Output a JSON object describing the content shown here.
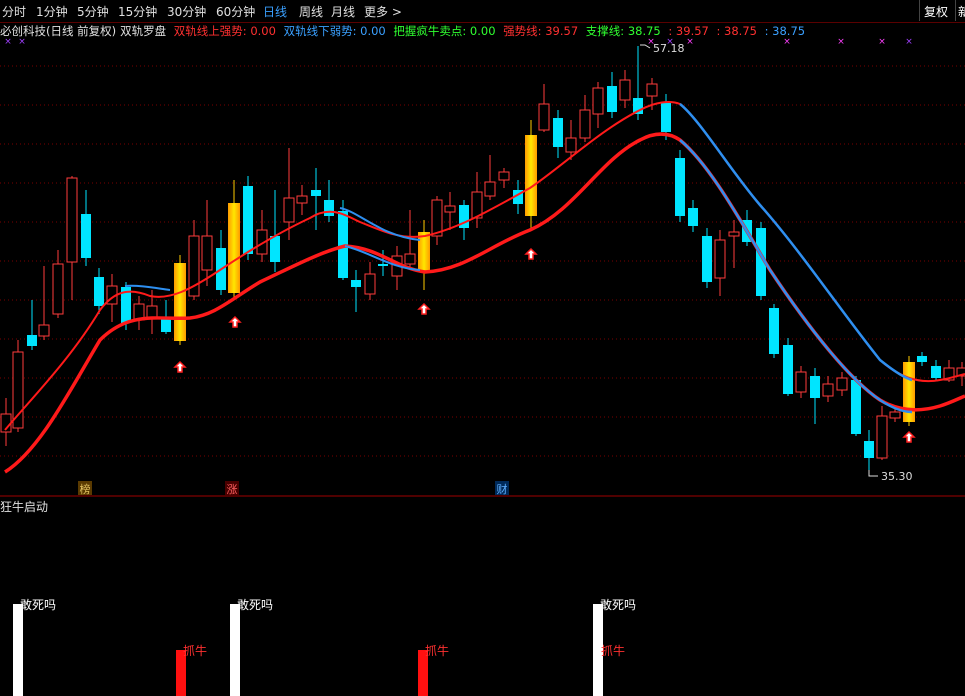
{
  "toolbar": {
    "periods": [
      "分时",
      "1分钟",
      "5分钟",
      "15分钟",
      "30分钟",
      "60分钟",
      "日线",
      "周线",
      "月线",
      "更多 >"
    ],
    "active": "日线",
    "fuquan": "复权",
    "right_edge": "新"
  },
  "legend": {
    "stock": "必创科技(日线 前复权)",
    "indicator": "双轨罗盘",
    "items": [
      {
        "label": "双轨线上强势: 0.00",
        "color": "#ff3030"
      },
      {
        "label": "双轨线下弱势: 0.00",
        "color": "#3aa0ff"
      },
      {
        "label": "把握疯牛卖点: 0.00",
        "color": "#30ff30"
      },
      {
        "label": "强势线: 39.57",
        "color": "#ff3030"
      },
      {
        "label": "支撑线: 38.75",
        "color": "#30ff30"
      },
      {
        "label": ": 39.57",
        "color": "#ff3030"
      },
      {
        "label": ": 38.75",
        "color": "#ff3030"
      },
      {
        "label": ": 38.75",
        "color": "#3aa0ff"
      }
    ]
  },
  "main_chart": {
    "high_label": "57.18",
    "low_label": "35.30",
    "event_tags": [
      {
        "text": "榜",
        "color": "#e0c060",
        "bg": "#5a3a00"
      },
      {
        "text": "涨",
        "color": "#ff6060",
        "bg": "#4a0000"
      },
      {
        "text": "财",
        "color": "#60b0ff",
        "bg": "#002a5a"
      }
    ]
  },
  "sub_chart": {
    "title": "狂牛启动",
    "signals": [
      {
        "kind": "white",
        "label": "敢死吗"
      },
      {
        "kind": "red",
        "label": "抓牛"
      },
      {
        "kind": "white",
        "label": "敢死吗"
      },
      {
        "kind": "red",
        "label": "抓牛"
      },
      {
        "kind": "white",
        "label": "敢死吗"
      },
      {
        "kind": "red",
        "label": "抓牛"
      }
    ]
  },
  "colors": {
    "up": "#ff3c3c",
    "down": "#00e5ff",
    "strong": "#ffcc00",
    "line_red": "#ff1a1a",
    "line_blue": "#2e8ff0",
    "grid": "#7a0000"
  }
}
